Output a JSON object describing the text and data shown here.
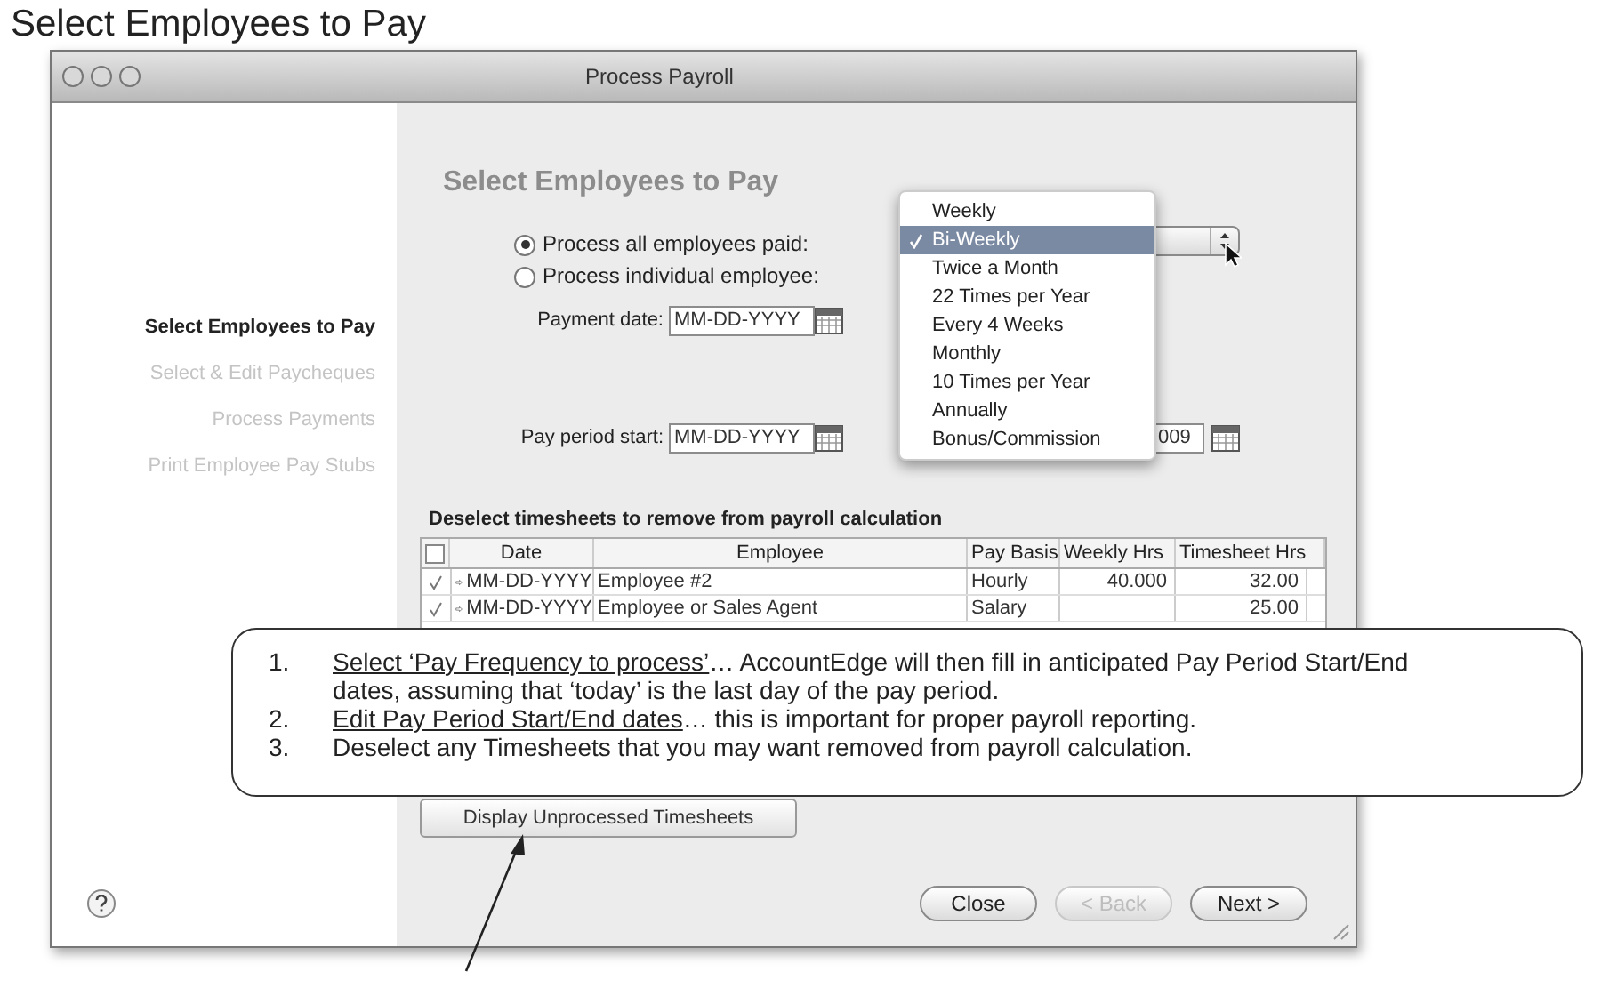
{
  "page_title": "Select Employees to Pay",
  "window": {
    "title": "Process Payroll"
  },
  "sidebar": {
    "items": [
      {
        "label": "Select Employees to Pay",
        "selected": true
      },
      {
        "label": "Select & Edit Paycheques",
        "selected": false
      },
      {
        "label": "Process Payments",
        "selected": false
      },
      {
        "label": "Print Employee Pay Stubs",
        "selected": false
      }
    ]
  },
  "heading": "Select Employees to Pay",
  "radios": [
    {
      "label": "Process all employees paid:",
      "selected": true
    },
    {
      "label": "Process individual employee:",
      "selected": false
    }
  ],
  "payment_date": {
    "label": "Payment date:",
    "value": "MM-DD-YYYY"
  },
  "pay_period_start": {
    "label": "Pay period start:",
    "value": "MM-DD-YYYY"
  },
  "pay_period_end": {
    "value": "009"
  },
  "frequency_menu": [
    {
      "label": "Weekly",
      "selected": false
    },
    {
      "label": "Bi-Weekly",
      "selected": true
    },
    {
      "label": "Twice a Month",
      "selected": false
    },
    {
      "label": "22 Times per Year",
      "selected": false
    },
    {
      "label": "Every 4 Weeks",
      "selected": false
    },
    {
      "label": "Monthly",
      "selected": false
    },
    {
      "label": "10 Times per Year",
      "selected": false
    },
    {
      "label": "Annually",
      "selected": false
    },
    {
      "label": "Bonus/Commission",
      "selected": false
    }
  ],
  "table": {
    "title": "Deselect timesheets to remove from payroll calculation",
    "select_all": false,
    "columns": [
      "Date",
      "Employee",
      "Pay Basis",
      "Weekly Hrs",
      "Timesheet Hrs"
    ],
    "rows": [
      {
        "included": true,
        "date": "MM-DD-YYYY",
        "employee": "Employee #2",
        "pay_basis": "Hourly",
        "weekly_hrs": "40.000",
        "timesheet_hrs": "32.00"
      },
      {
        "included": true,
        "date": "MM-DD-YYYY",
        "employee": "Employee or Sales Agent",
        "pay_basis": "Salary",
        "timesheet_hrs": "25.00"
      }
    ]
  },
  "display_button": "Display Unprocessed Timesheets",
  "buttons": [
    {
      "label": "Close",
      "disabled": false
    },
    {
      "label": "< Back",
      "disabled": true
    },
    {
      "label": "Next >",
      "disabled": false
    }
  ],
  "callout": [
    {
      "number": "1.",
      "underlined": "Select ‘Pay Frequency to process’",
      "text": "… AccountEdge will then fill in anticipated Pay Period Start/End dates, assuming that ‘today’ is the last day of the pay period."
    },
    {
      "number": "2.",
      "underlined": "Edit Pay Period Start/End dates",
      "text": "… this is important for proper payroll reporting."
    },
    {
      "number": "3.",
      "text": "Deselect any Timesheets that you may want removed from payroll calculation."
    }
  ]
}
